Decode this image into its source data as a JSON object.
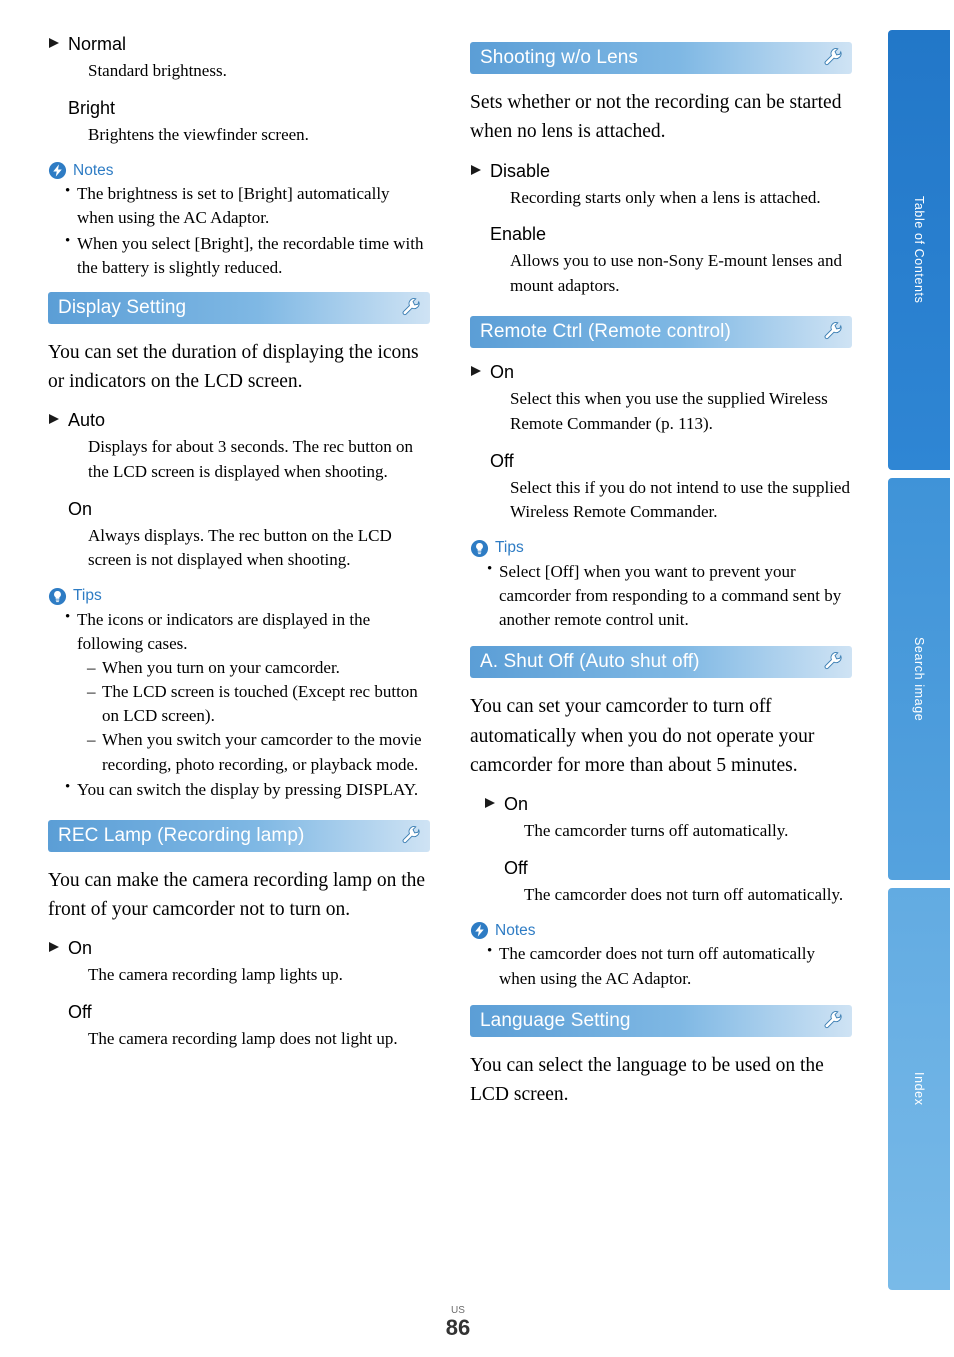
{
  "page": {
    "locale_code": "US",
    "number": "86"
  },
  "side_tabs": [
    {
      "label": "Table of Contents",
      "name": "tab-table-of-contents"
    },
    {
      "label": "Search image",
      "name": "tab-search-image"
    },
    {
      "label": "Index",
      "name": "tab-index"
    }
  ],
  "icons": {
    "wrench": "wrench-icon",
    "notes": "notes-icon",
    "tips": "tips-icon",
    "triangle": "triangle-bullet-icon"
  },
  "colors": {
    "header_bar_start": "#5b9ed6",
    "header_bar_end": "#cfe3f4",
    "accent_text": "#2e7cc4",
    "tab_blue": "#2277c8"
  },
  "left_column": {
    "top_options": [
      {
        "label": "Normal",
        "desc": "Standard brightness.",
        "marked": true
      },
      {
        "label": "Bright",
        "desc": "Brightens the viewfinder screen.",
        "marked": false
      }
    ],
    "notes_label": "Notes",
    "notes": [
      "The brightness is set to [Bright] automatically when using the AC Adaptor.",
      "When you select [Bright], the recordable time with the battery is slightly reduced."
    ],
    "sections": [
      {
        "title": "Display Setting",
        "body": "You can set the duration of displaying the icons or indicators on the LCD screen.",
        "options": [
          {
            "label": "Auto",
            "desc": "Displays for about 3 seconds. The rec button on the LCD screen is displayed when shooting.",
            "marked": true
          },
          {
            "label": "On",
            "desc": "Always displays. The rec button on the LCD screen is not displayed when shooting.",
            "marked": false
          }
        ],
        "tips_label": "Tips",
        "tips": [
          "The icons or indicators are displayed in the following cases.",
          "You can switch the display by pressing DISPLAY."
        ],
        "tips_sub": [
          "When you turn on your camcorder.",
          "The LCD screen is touched (Except rec button on LCD screen).",
          "When you switch your camcorder to the movie recording, photo recording, or playback mode."
        ]
      },
      {
        "title": "REC Lamp (Recording lamp)",
        "body": "You can make the camera recording lamp on the front of your camcorder not to turn on.",
        "options": [
          {
            "label": "On",
            "desc": "The camera recording lamp lights up.",
            "marked": true
          },
          {
            "label": "Off",
            "desc": "The camera recording lamp does not light up.",
            "marked": false
          }
        ]
      }
    ]
  },
  "right_column": {
    "sections": [
      {
        "title": "Shooting w/o Lens",
        "body": "Sets whether or not the recording can be started when no lens is attached.",
        "options": [
          {
            "label": "Disable",
            "desc": "Recording starts only when a lens is attached.",
            "marked": true
          },
          {
            "label": "Enable",
            "desc": "Allows you to use non-Sony E-mount lenses and mount adaptors.",
            "marked": false
          }
        ]
      },
      {
        "title": "Remote Ctrl (Remote control)",
        "body": "",
        "options": [
          {
            "label": "On",
            "desc": "Select this when you use the supplied Wireless Remote Commander (p. 113).",
            "marked": true
          },
          {
            "label": "Off",
            "desc": "Select this if you do not intend to use the supplied Wireless Remote Commander.",
            "marked": false
          }
        ],
        "tips_label": "Tips",
        "tips": [
          "Select [Off] when you want to prevent your camcorder from responding to a command sent by another remote control unit."
        ]
      },
      {
        "title": "A. Shut Off (Auto shut off)",
        "body": "You can set your camcorder to turn off automatically when you do not operate your camcorder for more than about 5 minutes.",
        "options": [
          {
            "label": "On",
            "desc": "The camcorder turns off automatically.",
            "marked": true
          },
          {
            "label": "Off",
            "desc": "The camcorder does not turn off automatically.",
            "marked": false
          }
        ],
        "notes_label": "Notes",
        "notes": [
          "The camcorder does not turn off automatically when using the AC Adaptor."
        ]
      },
      {
        "title": "Language Setting",
        "body": "You can select the language to be used on the LCD screen.",
        "options": []
      }
    ]
  }
}
